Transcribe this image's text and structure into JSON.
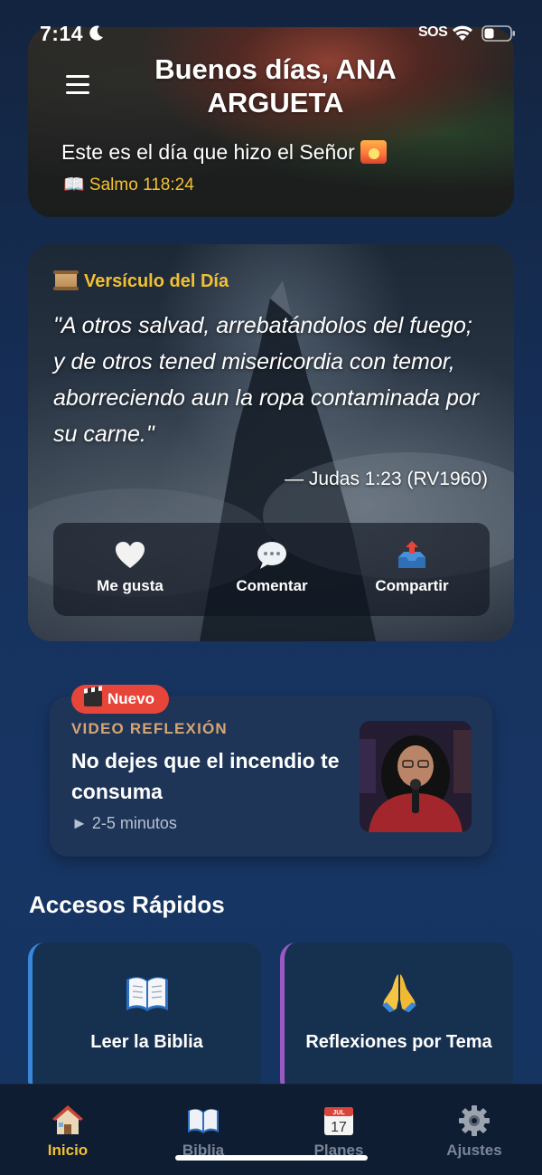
{
  "status": {
    "time": "7:14",
    "sos": "SOS"
  },
  "header": {
    "greeting": "Buenos días, ANA ARGUETA",
    "tagline": "Este es el día que hizo el Señor",
    "reference": "📖 Salmo 118:24"
  },
  "verse": {
    "label": "Versículo del Día",
    "text": "\"A otros salvad, arrebatándolos del fuego; y de otros tened misericordia con temor, aborreciendo aun la ropa contaminada por su carne.\"",
    "reference": "— Judas 1:23 (RV1960)",
    "actions": {
      "like": "Me gusta",
      "comment": "Comentar",
      "share": "Compartir"
    }
  },
  "video": {
    "badge": "Nuevo",
    "kicker": "VIDEO REFLEXIÓN",
    "title": "No dejes que el incendio te consuma",
    "duration": "► 2-5 minutos"
  },
  "quick_access": {
    "title": "Accesos Rápidos",
    "tiles": [
      {
        "label": "Leer la Biblia",
        "icon": "open-book-icon",
        "accent": "#3a86d8"
      },
      {
        "label": "Reflexiones por Tema",
        "icon": "praying-hands-icon",
        "accent": "#9b59c4"
      }
    ]
  },
  "tabs": [
    {
      "label": "Inicio",
      "icon": "home-icon",
      "active": true
    },
    {
      "label": "Biblia",
      "icon": "book-icon",
      "active": false
    },
    {
      "label": "Planes",
      "icon": "calendar-icon",
      "calendar_month": "JUL",
      "calendar_day": "17",
      "active": false
    },
    {
      "label": "Ajustes",
      "icon": "gear-icon",
      "active": false
    }
  ],
  "colors": {
    "accent_gold": "#f2c132",
    "badge_red": "#e8453a",
    "background": "#16305a"
  }
}
